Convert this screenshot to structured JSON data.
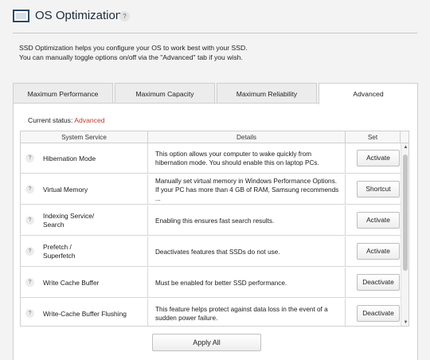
{
  "header": {
    "title": "OS Optimization",
    "help_glyph": "?",
    "app_icon": "monitor-icon"
  },
  "intro": {
    "line1": "SSD Optimization helps you configure your OS to work best with your SSD.",
    "line2": "You can manually toggle options on/off via the \"Advanced\" tab if you wish."
  },
  "tabs": [
    {
      "label": "Maximum Performance",
      "active": false
    },
    {
      "label": "Maximum Capacity",
      "active": false
    },
    {
      "label": "Maximum Reliability",
      "active": false
    },
    {
      "label": "Advanced",
      "active": true
    }
  ],
  "status": {
    "label": "Current status:",
    "value": "Advanced",
    "value_color": "#c0392b"
  },
  "table": {
    "headers": [
      "System Service",
      "Details",
      "Set"
    ],
    "rows": [
      {
        "help": "?",
        "service": "Hibernation Mode",
        "details": "This option allows your computer to wake quickly from\nhibernation mode. You should enable this on laptop PCs.",
        "action": "Activate"
      },
      {
        "help": "?",
        "service": "Virtual Memory",
        "details": "Manually set virtual memory in Windows Performance Options.\nIf your PC has more than 4 GB of RAM, Samsung recommends ...",
        "action": "Shortcut"
      },
      {
        "help": "?",
        "service": "Indexing Service/\nSearch",
        "details": "Enabling this ensures fast search results.",
        "action": "Activate"
      },
      {
        "help": "?",
        "service": "Prefetch /\nSuperfetch",
        "details": "Deactivates features that SSDs do not use.",
        "action": "Activate"
      },
      {
        "help": "?",
        "service": "Write Cache Buffer",
        "details": "Must be enabled for better SSD performance.",
        "action": "Deactivate"
      },
      {
        "help": "?",
        "service": "Write-Cache Buffer Flushing",
        "details": "This feature helps protect against data loss in the event of a\nsudden power failure.",
        "action": "Deactivate"
      }
    ]
  },
  "scrollbar": {
    "up_glyph": "▲",
    "down_glyph": "▼"
  },
  "footer": {
    "apply_label": "Apply All"
  }
}
